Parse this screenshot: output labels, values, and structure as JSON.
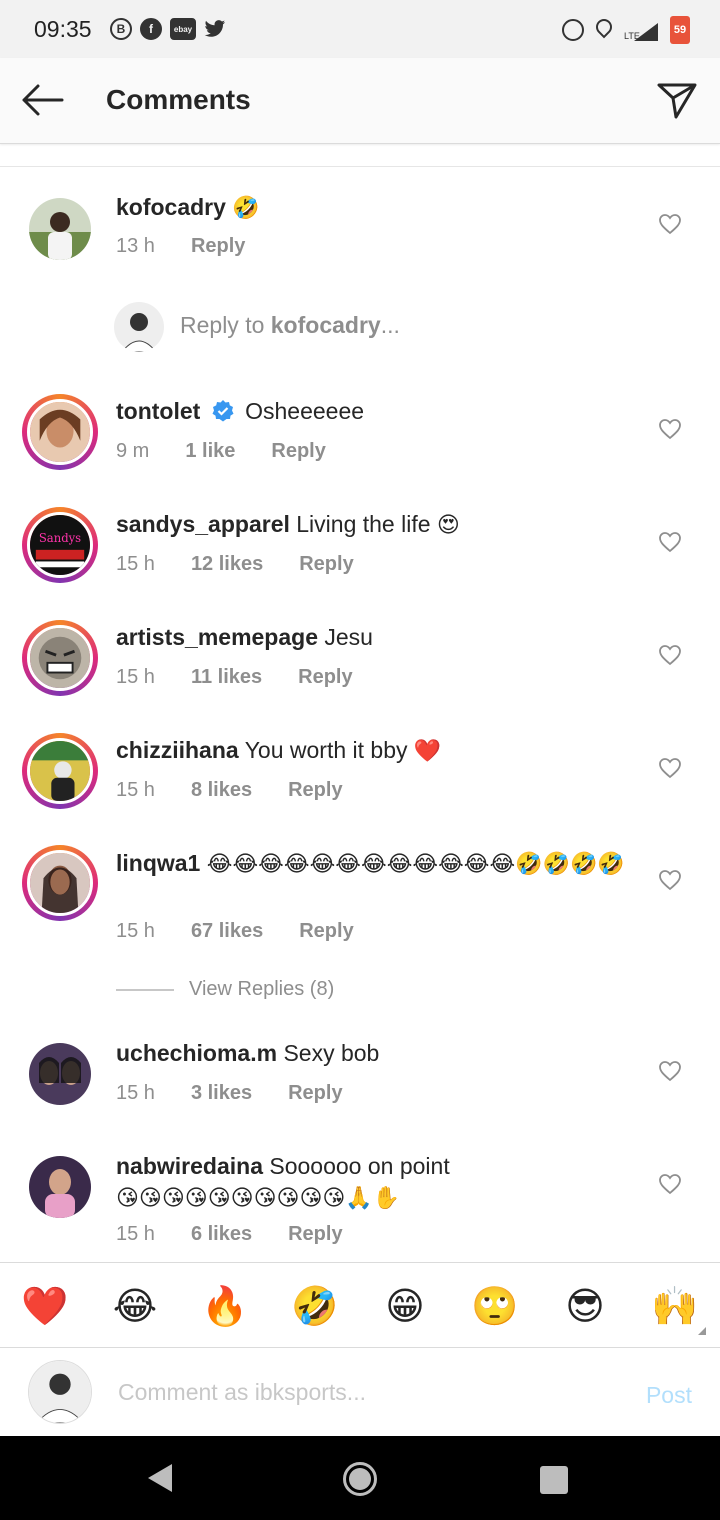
{
  "status_bar": {
    "time": "09:35",
    "left_icons": [
      "blogger-icon",
      "facebook-icon",
      "ebay-icon",
      "twitter-icon"
    ],
    "right_icons": [
      "alarm-icon",
      "location-icon",
      "signal-icon",
      "battery-icon"
    ],
    "network": "LTE",
    "battery": "59"
  },
  "header": {
    "title": "Comments"
  },
  "colors": {
    "accent_link": "#b2dffc",
    "muted_text": "#8e8e8e",
    "verified": "#3897f0",
    "heart": "#e0245e"
  },
  "comments": [
    {
      "username": "kofocadry",
      "text": "",
      "emoji": "🤣",
      "time": "13 h",
      "likes": "",
      "reply": "Reply"
    },
    {
      "username": "tontolet",
      "text": "Osheeeeee",
      "time": "9 m",
      "likes": "1 like",
      "reply": "Reply",
      "verified": true
    },
    {
      "username": "sandys_apparel",
      "text": "Living the life",
      "emoji": "😍",
      "time": "15 h",
      "likes": "12 likes",
      "reply": "Reply"
    },
    {
      "username": "artists_memepage",
      "text": "Jesu",
      "time": "15 h",
      "likes": "11 likes",
      "reply": "Reply"
    },
    {
      "username": "chizziihana",
      "text": "You worth it bby",
      "emoji": "❤️",
      "time": "15 h",
      "likes": "8 likes",
      "reply": "Reply"
    },
    {
      "username": "linqwa1",
      "text": "",
      "emoji": "😂😂😂😂😂😂😂😂😂😂😂😂🤣🤣🤣🤣",
      "time": "15 h",
      "likes": "67 likes",
      "reply": "Reply"
    },
    {
      "username": "uchechioma.m",
      "text": "Sexy bob",
      "time": "15 h",
      "likes": "3 likes",
      "reply": "Reply"
    },
    {
      "username": "nabwiredaina",
      "text": "Soooooo on point",
      "emoji": "😘😘😘😘😘😘😘😘😘😘🙏✋",
      "time": "15 h",
      "likes": "6 likes",
      "reply": "Reply"
    }
  ],
  "reply_to": {
    "prefix": "Reply to ",
    "username": "kofocadry",
    "suffix": "..."
  },
  "view_replies": "View Replies (8)",
  "emoji_bar": [
    "❤️",
    "😂",
    "🔥",
    "🤣",
    "😁",
    "🙄",
    "😎",
    "🙌"
  ],
  "composer": {
    "placeholder": "Comment as ibksports...",
    "post_label": "Post"
  }
}
